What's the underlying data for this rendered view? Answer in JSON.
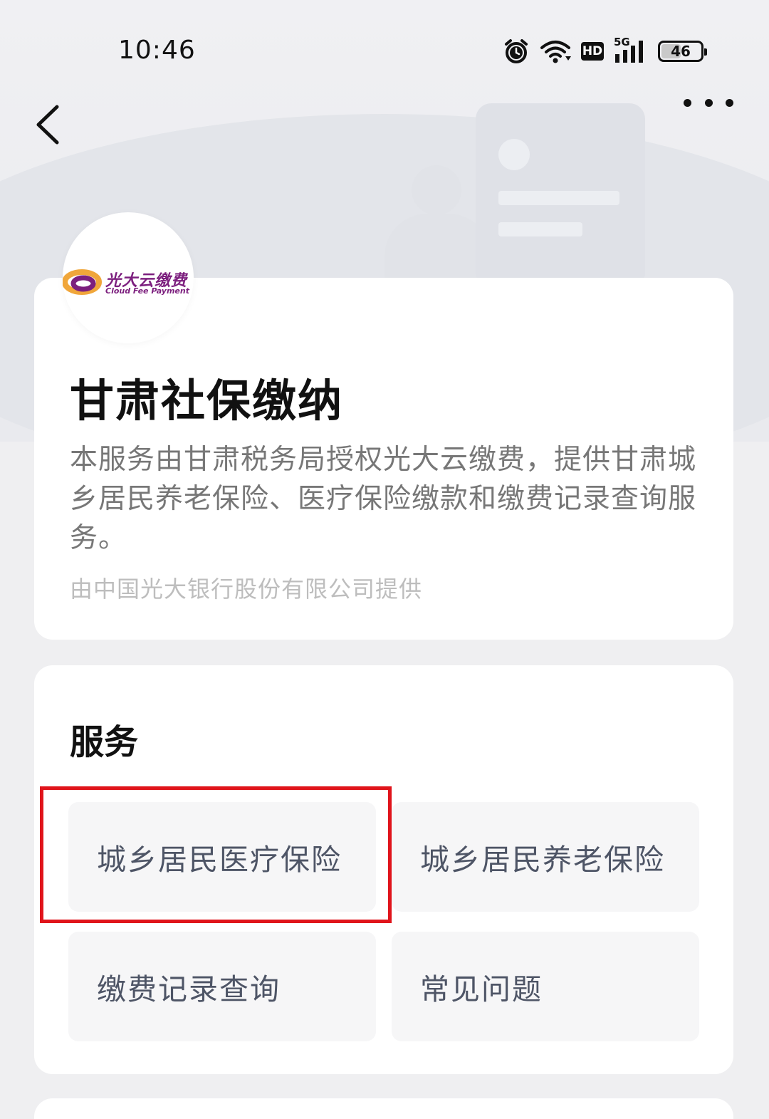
{
  "status_bar": {
    "time": "10:46",
    "hd_label": "HD",
    "network_label": "5G",
    "battery_level": "46",
    "icons": [
      "alarm-icon",
      "wifi-icon",
      "hd-icon",
      "signal-icon",
      "battery-icon"
    ]
  },
  "nav": {
    "back_icon": "chevron-left-icon",
    "more_icon": "more-dots-icon"
  },
  "brand": {
    "name_cn": "光大云缴费",
    "name_en": "Cloud Fee Payment",
    "color": "#7c1f7e",
    "accent": "#f0a63a"
  },
  "intro": {
    "title": "甘肃社保缴纳",
    "description": "本服务由甘肃税务局授权光大云缴费，提供甘肃城乡居民养老保险、医疗保险缴款和缴费记录查询服务。",
    "provider": "由中国光大银行股份有限公司提供"
  },
  "services": {
    "title": "服务",
    "items": [
      {
        "label": "城乡居民医疗保险",
        "highlighted": true
      },
      {
        "label": "城乡居民养老保险",
        "highlighted": false
      },
      {
        "label": "缴费记录查询",
        "highlighted": false
      },
      {
        "label": "常见问题",
        "highlighted": false
      }
    ],
    "highlight_color": "#e0141b"
  }
}
